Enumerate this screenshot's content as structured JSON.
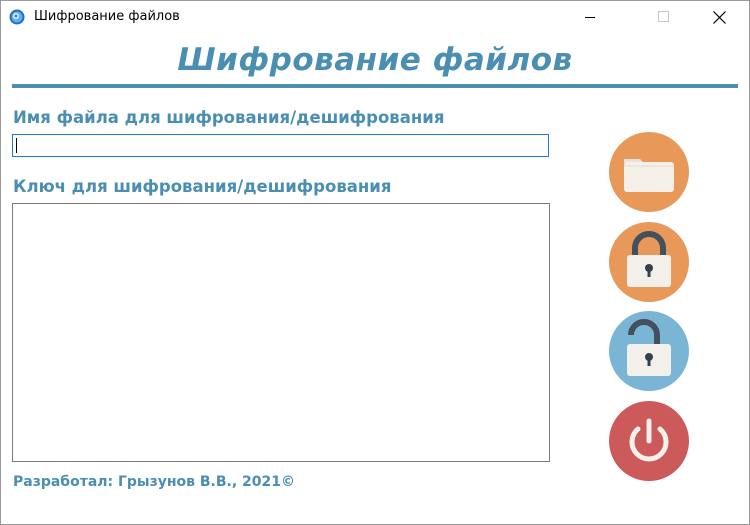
{
  "window": {
    "title": "Шифрование файлов",
    "controls": [
      "minimize",
      "maximize",
      "close"
    ]
  },
  "header": {
    "title": "Шифрование файлов",
    "accent_color": "#4a8eb2"
  },
  "form": {
    "file_label": "Имя файла для шифрования/дешифрования",
    "file_value": "",
    "key_label": "Ключ для шифрования/дешифрования",
    "key_value": ""
  },
  "actions": [
    {
      "name": "open-file",
      "icon": "folder-icon",
      "color": "#e8995a"
    },
    {
      "name": "encrypt",
      "icon": "lock-closed-icon",
      "color": "#e8995a"
    },
    {
      "name": "decrypt",
      "icon": "lock-open-icon",
      "color": "#7ab5d6"
    },
    {
      "name": "exit",
      "icon": "power-icon",
      "color": "#cc5a5a"
    }
  ],
  "footer": {
    "text": "Разработал: Грызунов В.В., 2021©"
  }
}
